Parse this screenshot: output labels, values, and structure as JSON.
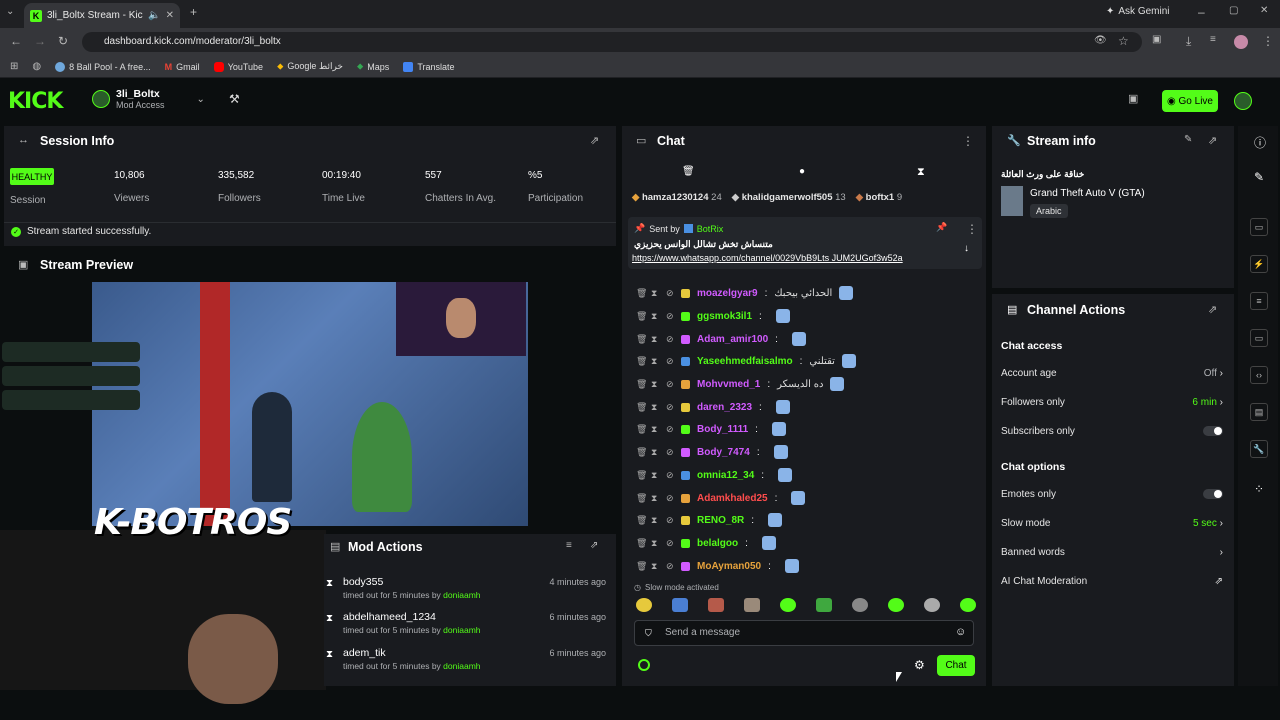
{
  "browser": {
    "tab_title": "3li_Boltx Stream - Kick Das",
    "url": "dashboard.kick.com/moderator/3li_boltx",
    "ask_gemini": "Ask Gemini",
    "bookmarks": [
      "8 Ball Pool - A free...",
      "Gmail",
      "YouTube",
      "Google خرائط",
      "Maps",
      "Translate"
    ]
  },
  "header": {
    "logo": "KICK",
    "channel_name": "3li_Boltx",
    "access": "Mod Access",
    "go_live": "Go Live"
  },
  "session": {
    "title": "Session Info",
    "health": "HEALTHY",
    "health_label": "Session",
    "stats": [
      {
        "value": "10,806",
        "label": "Viewers"
      },
      {
        "value": "335,582",
        "label": "Followers"
      },
      {
        "value": "00:19:40",
        "label": "Time Live"
      },
      {
        "value": "557",
        "label": "Chatters In Avg."
      },
      {
        "value": "%5",
        "label": "Participation"
      }
    ],
    "status_message": "Stream started successfully."
  },
  "preview": {
    "title": "Stream Preview",
    "overlay_text": "K-BOTROS"
  },
  "mod_actions": {
    "title": "Mod Actions",
    "items": [
      {
        "user": "body355",
        "action": "timed out for 5 minutes by",
        "by": "doniaamh",
        "time": "4 minutes ago"
      },
      {
        "user": "abdelhameed_1234",
        "action": "timed out for 5 minutes by",
        "by": "doniaamh",
        "time": "6 minutes ago"
      },
      {
        "user": "adem_tik",
        "action": "timed out for 5 minutes by",
        "by": "doniaamh",
        "time": "6 minutes ago"
      }
    ]
  },
  "chat": {
    "title": "Chat",
    "top_gifters": [
      {
        "name": "hamza1230124",
        "count": "24"
      },
      {
        "name": "khalidgamerwolf505",
        "count": "13"
      },
      {
        "name": "boftx1",
        "count": "9"
      }
    ],
    "pinned": {
      "sent_by_label": "Sent by",
      "sender": "BotRix",
      "text": "متنساش تخش تشالل الوانس يحزيزي",
      "link": "https://www.whatsapp.com/channel/0029VbB9Lts JUM2UGof3w52a"
    },
    "messages": [
      {
        "user": "moazelgyar9",
        "text": "الحدائي بيحبك",
        "color": "#d15bff"
      },
      {
        "user": "ggsmok3il1",
        "text": "",
        "color": "#53fc18"
      },
      {
        "user": "Adam_amir100",
        "text": "",
        "color": "#d15bff"
      },
      {
        "user": "Yaseehmedfaisalmo",
        "text": "تقتلني",
        "color": "#53fc18"
      },
      {
        "user": "Mohvvmed_1",
        "text": "ده الديسكر",
        "color": "#d15bff"
      },
      {
        "user": "daren_2323",
        "text": "",
        "color": "#d15bff"
      },
      {
        "user": "Body_1111",
        "text": "",
        "color": "#d15bff"
      },
      {
        "user": "Body_7474",
        "text": "",
        "color": "#d15bff"
      },
      {
        "user": "omnia12_34",
        "text": "",
        "color": "#53fc18"
      },
      {
        "user": "Adamkhaled25",
        "text": "",
        "color": "#ff4d4d"
      },
      {
        "user": "RENO_8R",
        "text": "",
        "color": "#53fc18"
      },
      {
        "user": "belalgoo",
        "text": "",
        "color": "#53fc18"
      },
      {
        "user": "MoAyman050",
        "text": "",
        "color": "#e6a23c"
      }
    ],
    "slow_mode_notice": "Slow mode activated",
    "input_placeholder": "Send a message",
    "send_button": "Chat"
  },
  "stream_info": {
    "title": "Stream info",
    "stream_title": "خناقة على ورث العائلة",
    "category": "Grand Theft Auto V (GTA)",
    "language": "Arabic"
  },
  "channel_actions": {
    "title": "Channel Actions",
    "chat_access_heading": "Chat access",
    "chat_options_heading": "Chat options",
    "account_age": {
      "label": "Account age",
      "value": "Off"
    },
    "followers_only": {
      "label": "Followers only",
      "value": "6 min"
    },
    "subscribers_only": {
      "label": "Subscribers only"
    },
    "emotes_only": {
      "label": "Emotes only"
    },
    "slow_mode": {
      "label": "Slow mode",
      "value": "5 sec"
    },
    "banned_words": {
      "label": "Banned words"
    },
    "ai_moderation": {
      "label": "AI Chat Moderation"
    }
  },
  "colors": {
    "accent": "#53fc18",
    "panel": "#191b1f",
    "bg": "#0b0e0f"
  }
}
